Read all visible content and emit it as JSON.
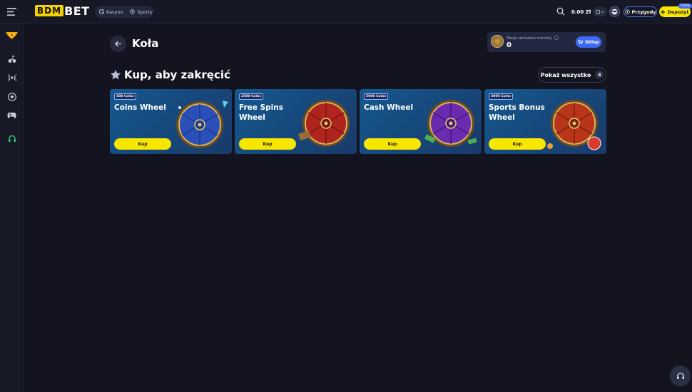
{
  "header": {
    "logo_left": "BDM",
    "logo_right": "BET",
    "modes": [
      {
        "label": "Kasyno",
        "icon": "casino-icon"
      },
      {
        "label": "Sporty",
        "icon": "sports-icon"
      }
    ],
    "balance": "0.00 Zł",
    "adventures_label": "Przygody",
    "deposit_label": "Depozyt",
    "deposit_badge": "100%"
  },
  "sidebar": {
    "items": [
      {
        "icon": "promo-shield-icon"
      },
      {
        "icon": "cycling-icon"
      },
      {
        "icon": "live-icon"
      },
      {
        "icon": "football-icon"
      },
      {
        "icon": "esports-controller-icon"
      },
      {
        "icon": "headset-icon"
      }
    ]
  },
  "page": {
    "title": "Koła",
    "coins_label": "Twoje aktualne monety",
    "coins_value": "0",
    "shop_label": "Sklep"
  },
  "section": {
    "title": "Kup, aby zakręcić",
    "show_all_label": "Pokaż wszystko",
    "show_all_count": "4"
  },
  "wheels": [
    {
      "price": "500 Coins",
      "name": "Coins Wheel",
      "buy": "Kup",
      "color": "#2a4fb8"
    },
    {
      "price": "2500 Coins",
      "name": "Free Spins Wheel",
      "buy": "Kup",
      "color": "#b0241e"
    },
    {
      "price": "5000 Coins",
      "name": "Cash Wheel",
      "buy": "Kup",
      "color": "#6a2bb0"
    },
    {
      "price": "3000 Coins",
      "name": "Sports Bonus Wheel",
      "buy": "Kup",
      "color": "#b8351a"
    }
  ],
  "colors": {
    "accent_yellow": "#f7e600",
    "accent_blue": "#3d6af5",
    "background": "#13141f"
  }
}
